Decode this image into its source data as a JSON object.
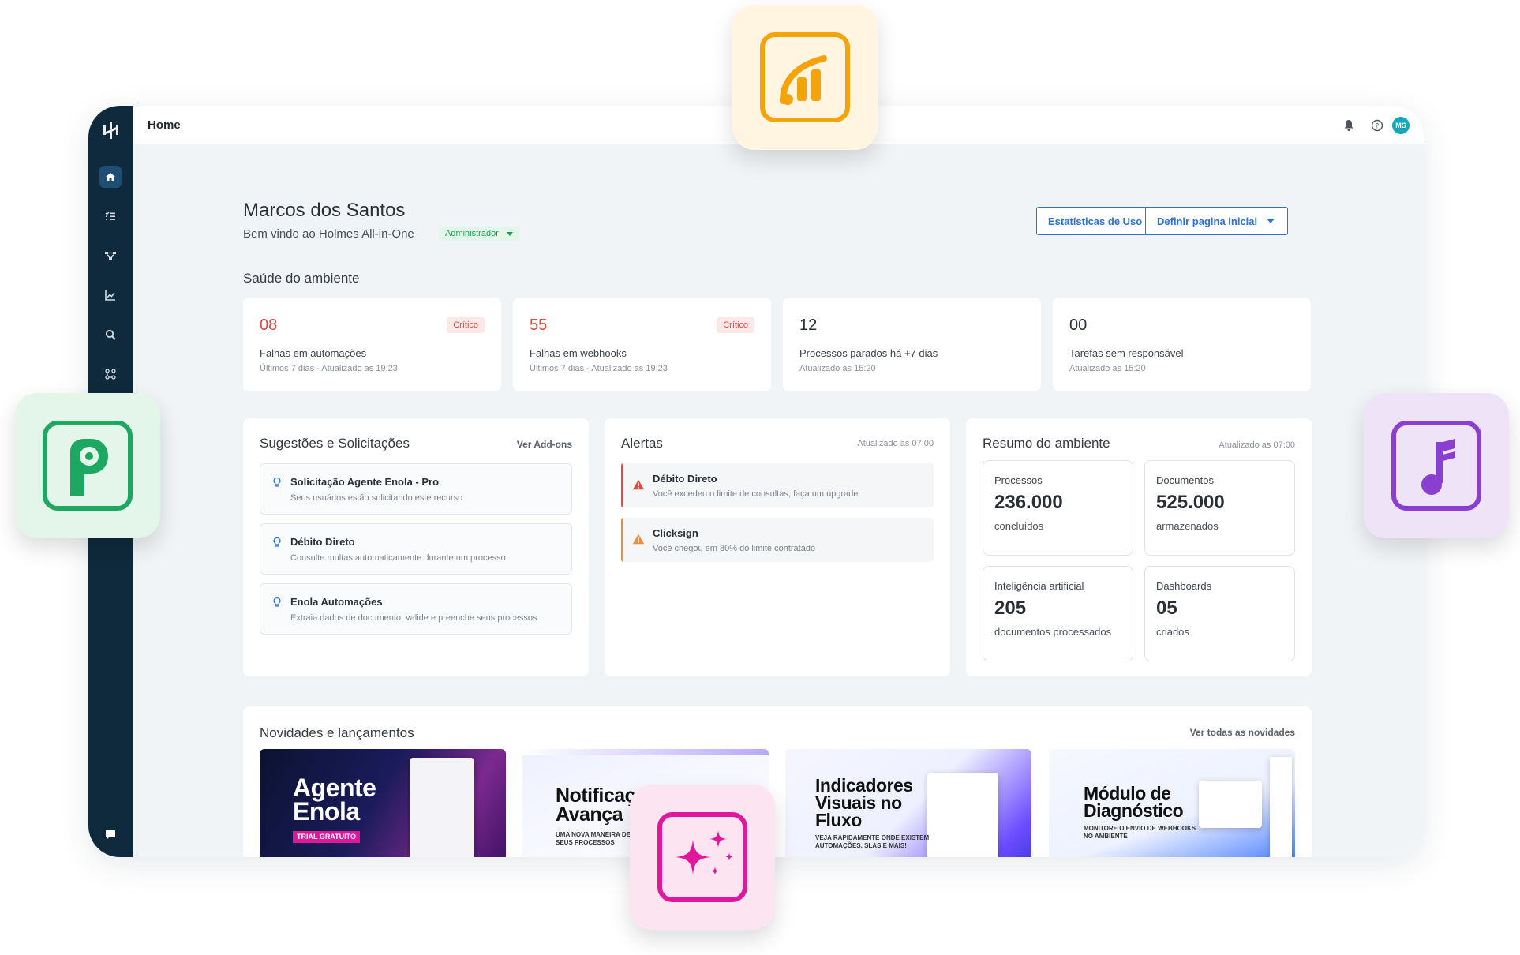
{
  "topbar": {
    "title": "Home",
    "avatar_initials": "MS"
  },
  "sidebar": {
    "items": [
      {
        "name": "home",
        "icon": "home-icon",
        "active": true
      },
      {
        "name": "tasks",
        "icon": "list-check-icon"
      },
      {
        "name": "workflows",
        "icon": "flow-icon"
      },
      {
        "name": "reports",
        "icon": "chart-icon"
      },
      {
        "name": "search",
        "icon": "search-icon"
      },
      {
        "name": "integrations",
        "icon": "nodes-icon"
      }
    ],
    "bottom_icon": "chat-icon"
  },
  "header": {
    "user_name": "Marcos dos Santos",
    "welcome": "Bem vindo ao Holmes All-in-One",
    "role": "Administrador",
    "btn_stats": "Estatísticas de Uso",
    "btn_home": "Definir pagina inicial"
  },
  "health": {
    "title": "Saúde do ambiente",
    "cards": [
      {
        "value": "08",
        "label": "Falhas em automações",
        "sub": "Últimos 7 dias - Atualizado as 19:23",
        "badge": "Crítico"
      },
      {
        "value": "55",
        "label": "Falhas em webhooks",
        "sub": "Últimos 7 dias - Atualizado as 19:23",
        "badge": "Crítico"
      },
      {
        "value": "12",
        "label": "Processos parados há +7 dias",
        "sub": "Atualizado as 15:20"
      },
      {
        "value": "00",
        "label": "Tarefas sem responsável",
        "sub": "Atualizado as 15:20"
      }
    ]
  },
  "suggestions": {
    "title": "Sugestões e Solicitações",
    "link": "Ver Add-ons",
    "items": [
      {
        "title": "Solicitação Agente Enola - Pro",
        "desc": "Seus usuários estão solicitando este recurso"
      },
      {
        "title": "Débito Direto",
        "desc": "Consulte multas automaticamente durante um processo"
      },
      {
        "title": "Enola Automações",
        "desc": "Extraia dados de documento, valide e preenche seus processos"
      }
    ]
  },
  "alerts": {
    "title": "Alertas",
    "updated": "Atualizado as 07:00",
    "items": [
      {
        "title": "Débito Direto",
        "desc": "Você excedeu o limite de consultas, faça um upgrade",
        "color": "#e5483e"
      },
      {
        "title": "Clicksign",
        "desc": "Você chegou em 80% do limite contratado",
        "color": "#f08a3c"
      }
    ]
  },
  "summary": {
    "title": "Resumo do ambiente",
    "updated": "Atualizado as 07:00",
    "cards": [
      {
        "label": "Processos",
        "value": "236.000",
        "sub": "concluídos"
      },
      {
        "label": "Documentos",
        "value": "525.000",
        "sub": "armazenados"
      },
      {
        "label": "Inteligência artificial",
        "value": "205",
        "sub": "documentos processados"
      },
      {
        "label": "Dashboards",
        "value": "05",
        "sub": "criados"
      }
    ]
  },
  "news": {
    "title": "Novidades e lançamentos",
    "link": "Ver todas as novidades",
    "cards": [
      {
        "headline": "Agente\nEnola",
        "tag": "TRIAL GRATUITO"
      },
      {
        "headline": "Notificaç\nAvança",
        "tag": "UMA NOVA MANEIRA DE N\nSEUS PROCESSOS"
      },
      {
        "headline": "Indicadores\nVisuais no\nFluxo",
        "tag": "VEJA RAPIDAMENTE ONDE EXISTEM\nAUTOMAÇÕES, SLAS E MAIS!"
      },
      {
        "headline": "Módulo de\nDiagnóstico",
        "tag": "MONITORE O ENVIO DE WEBHOOKS\nNO AMBIENTE"
      }
    ]
  },
  "colors": {
    "sidebar": "#0f2a3d",
    "accent_blue": "#2b72d6",
    "critical": "#e0483f",
    "success": "#1f9d55"
  },
  "floating_icons": [
    {
      "name": "analytics-app-icon",
      "bg": "#fff5e0",
      "fg": "#f4a30b"
    },
    {
      "name": "settings-app-icon",
      "bg": "#e4f5ea",
      "fg": "#1ea760"
    },
    {
      "name": "music-app-icon",
      "bg": "#efe4f7",
      "fg": "#8a3fd1"
    },
    {
      "name": "sparkle-app-icon",
      "bg": "#fde4f1",
      "fg": "#e0179b"
    }
  ]
}
